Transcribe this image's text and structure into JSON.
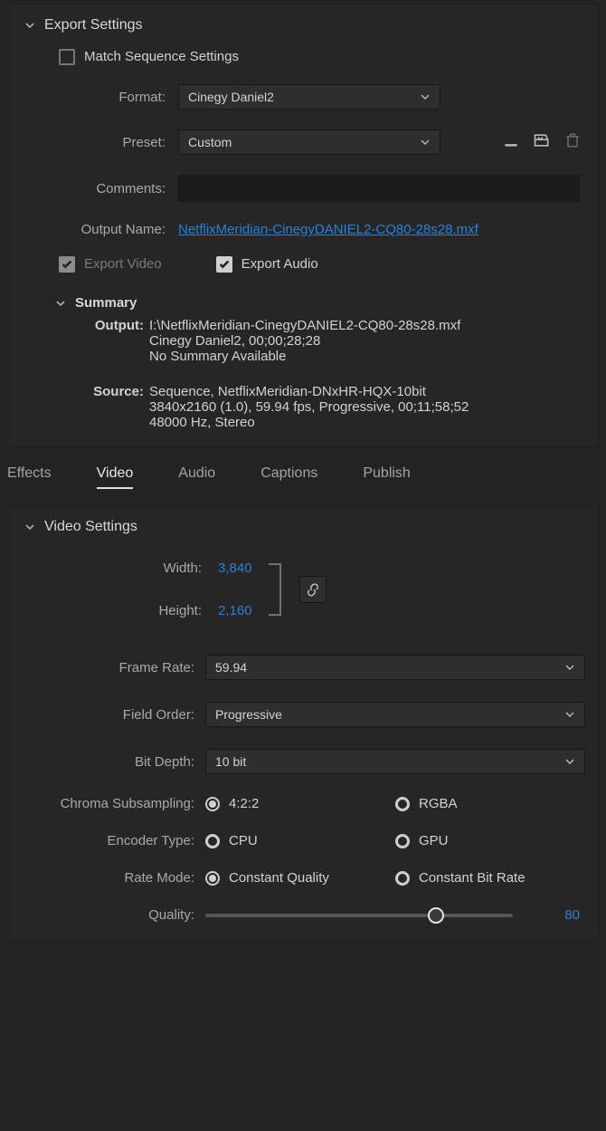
{
  "exportSettings": {
    "title": "Export Settings",
    "matchSequenceLabel": "Match Sequence Settings",
    "matchSequenceChecked": false,
    "formatLabel": "Format:",
    "formatValue": "Cinegy Daniel2",
    "presetLabel": "Preset:",
    "presetValue": "Custom",
    "commentsLabel": "Comments:",
    "commentsValue": "",
    "outputNameLabel": "Output Name:",
    "outputNameValue": "NetflixMeridian-CinegyDANIEL2-CQ80-28s28.mxf",
    "exportVideoLabel": "Export Video",
    "exportVideoChecked": true,
    "exportVideoDisabled": true,
    "exportAudioLabel": "Export Audio",
    "exportAudioChecked": true,
    "summary": {
      "title": "Summary",
      "outputKey": "Output:",
      "outputLines": "I:\\NetflixMeridian-CinegyDANIEL2-CQ80-28s28.mxf\nCinegy Daniel2, 00;00;28;28\nNo Summary Available",
      "sourceKey": "Source:",
      "sourceLines": "Sequence, NetflixMeridian-DNxHR-HQX-10bit\n3840x2160 (1.0), 59.94 fps, Progressive, 00;11;58;52\n48000 Hz, Stereo"
    }
  },
  "tabs": {
    "effects": "Effects",
    "video": "Video",
    "audio": "Audio",
    "captions": "Captions",
    "publish": "Publish",
    "active": "video"
  },
  "videoSettings": {
    "title": "Video Settings",
    "widthLabel": "Width:",
    "widthValue": "3,840",
    "heightLabel": "Height:",
    "heightValue": "2,160",
    "linkEnabled": true,
    "frameRateLabel": "Frame Rate:",
    "frameRateValue": "59.94",
    "fieldOrderLabel": "Field Order:",
    "fieldOrderValue": "Progressive",
    "bitDepthLabel": "Bit Depth:",
    "bitDepthValue": "10 bit",
    "chromaLabel": "Chroma Subsampling:",
    "chromaOptions": {
      "a": "4:2:2",
      "b": "RGBA",
      "selected": "a"
    },
    "encoderLabel": "Encoder Type:",
    "encoderOptions": {
      "a": "CPU",
      "b": "GPU",
      "selected": ""
    },
    "rateModeLabel": "Rate Mode:",
    "rateModeOptions": {
      "a": "Constant Quality",
      "b": "Constant Bit Rate",
      "selected": "a"
    },
    "qualityLabel": "Quality:",
    "qualityValue": "80",
    "qualityPercent": 75
  }
}
